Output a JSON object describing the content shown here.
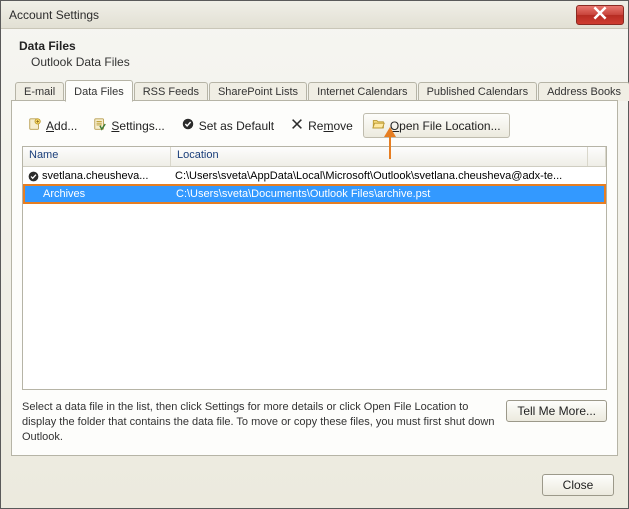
{
  "window": {
    "title": "Account Settings"
  },
  "header": {
    "title": "Data Files",
    "subtitle": "Outlook Data Files"
  },
  "tabs": [
    {
      "label": "E-mail"
    },
    {
      "label": "Data Files"
    },
    {
      "label": "RSS Feeds"
    },
    {
      "label": "SharePoint Lists"
    },
    {
      "label": "Internet Calendars"
    },
    {
      "label": "Published Calendars"
    },
    {
      "label": "Address Books"
    }
  ],
  "active_tab_index": 1,
  "toolbar": {
    "add_pre": "A",
    "add_post": "dd...",
    "settings_pre": "S",
    "settings_post": "ettings...",
    "default": "Set as Default",
    "remove_pre": "Re",
    "remove_mid": "m",
    "remove_post": "ove",
    "open_pre": "O",
    "open_post": "pen File Location..."
  },
  "columns": {
    "name": "Name",
    "location": "Location"
  },
  "rows": [
    {
      "default": true,
      "selected": false,
      "name": "svetlana.cheusheva...",
      "location": "C:\\Users\\sveta\\AppData\\Local\\Microsoft\\Outlook\\svetlana.cheusheva@adx-te..."
    },
    {
      "default": false,
      "selected": true,
      "name": "Archives",
      "location": "C:\\Users\\sveta\\Documents\\Outlook Files\\archive.pst"
    }
  ],
  "hint": "Select a data file in the list, then click Settings for more details or click Open File Location to display the folder that contains the data file. To move or copy these files, you must first shut down Outlook.",
  "tell_me_more_pre": "T",
  "tell_me_more_post": "ell Me More...",
  "close_pre": "C",
  "close_post": "lose",
  "annotation": {
    "arrow_color": "#e67e22"
  }
}
